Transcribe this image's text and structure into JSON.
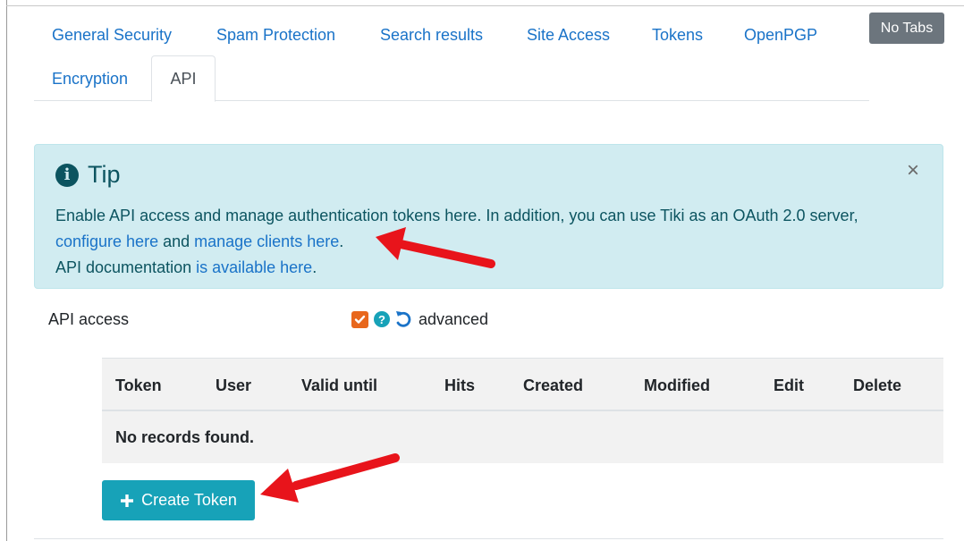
{
  "tabs": [
    {
      "label": "General Security"
    },
    {
      "label": "Spam Protection"
    },
    {
      "label": "Search results"
    },
    {
      "label": "Site Access"
    },
    {
      "label": "Tokens"
    },
    {
      "label": "OpenPGP"
    },
    {
      "label": "Encryption"
    },
    {
      "label": "API"
    }
  ],
  "no_tabs_label": "No Tabs",
  "tip": {
    "title": "Tip",
    "text_1": "Enable API access and manage authentication tokens here. In addition, you can use Tiki as an OAuth 2.0 server,",
    "link_configure": "configure here",
    "text_and": " and ",
    "link_manage": "manage clients here",
    "text_period": ".",
    "text_docs": "API documentation ",
    "link_docs": "is available here",
    "close": "×"
  },
  "pref": {
    "label": "API access",
    "checked": true,
    "help": "?",
    "advanced": "advanced"
  },
  "table": {
    "columns": [
      "Token",
      "User",
      "Valid until",
      "Hits",
      "Created",
      "Modified",
      "Edit",
      "Delete"
    ],
    "empty_text": "No records found."
  },
  "create_token_label": "Create Token",
  "colors": {
    "link": "#1a73c8",
    "tip_bg": "#d1ecf1",
    "accent_button": "#17a2b8",
    "checkbox": "#e8671c",
    "arrow": "#e8141b"
  }
}
